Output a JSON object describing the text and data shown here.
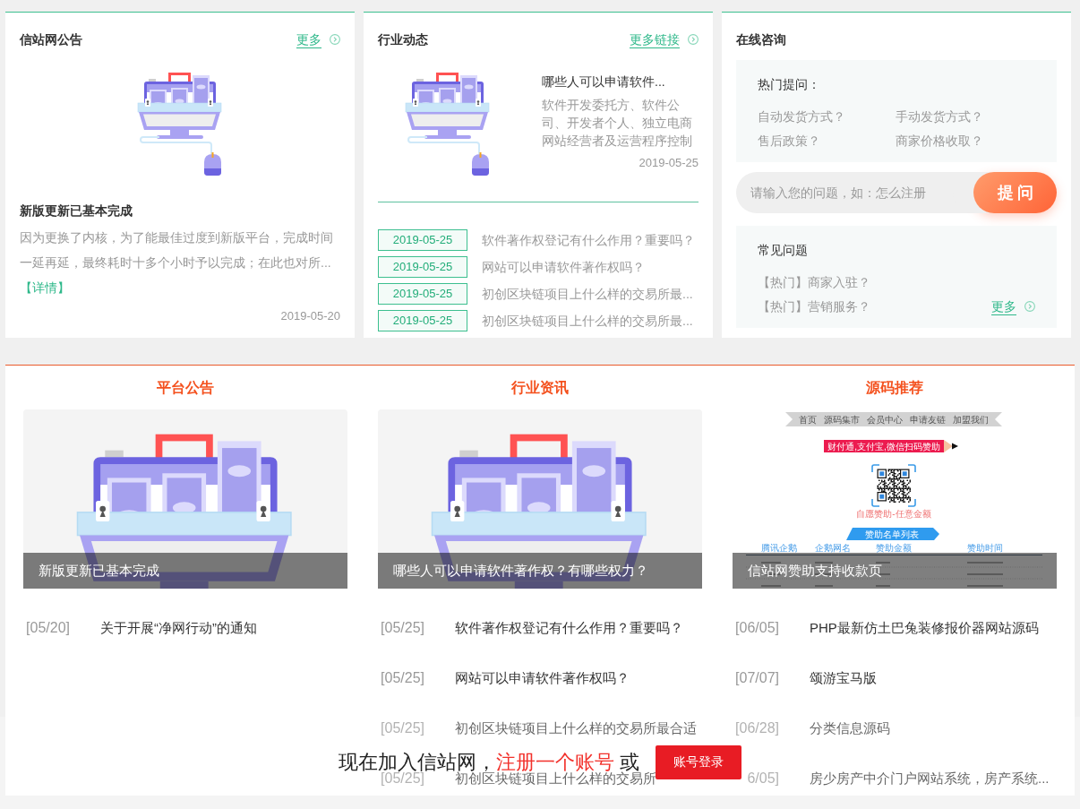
{
  "notice_card": {
    "title": "信站网公告",
    "more_link": "更多",
    "headline": "新版更新已基本完成",
    "summary": "因为更换了内核，为了能最佳过度到新版平台，完成时间一延再延，最终耗时十多个小时予以完成；在此也对所...",
    "detail_link": "【详情】",
    "date": "2019-05-20"
  },
  "industry_card": {
    "title": "行业动态",
    "more_link": "更多链接",
    "featured": {
      "title": "哪些人可以申请软件...",
      "summary": "软件开发委托方、软件公司、开发者个人、独立电商网站经营者及运营程序控制",
      "date": "2019-05-25"
    },
    "items": [
      {
        "date": "2019-05-25",
        "title": "软件著作权登记有什么作用？重要吗？"
      },
      {
        "date": "2019-05-25",
        "title": "网站可以申请软件著作权吗？"
      },
      {
        "date": "2019-05-25",
        "title": "初创区块链项目上什么样的交易所最..."
      },
      {
        "date": "2019-05-25",
        "title": "初创区块链项目上什么样的交易所最..."
      }
    ]
  },
  "consult_card": {
    "title": "在线咨询",
    "hot_questions": {
      "heading": "热门提问：",
      "items": [
        "自动发货方式？",
        "手动发货方式？",
        "售后政策？",
        "商家价格收取？"
      ]
    },
    "ask": {
      "placeholder": "请输入您的问题，如：怎么注册",
      "button": "提问"
    },
    "faq": {
      "heading": "常见问题",
      "items": [
        "【热门】商家入驻？",
        "【热门】营销服务？"
      ],
      "more_link": "更多"
    }
  },
  "columns": [
    {
      "title": "平台公告",
      "feature": {
        "kind": "illustration",
        "caption": "新版更新已基本完成"
      },
      "items": [
        {
          "date": "[05/20]",
          "title": "关于开展“净网行动”的通知"
        }
      ]
    },
    {
      "title": "行业资讯",
      "feature": {
        "kind": "illustration",
        "caption": "哪些人可以申请软件著作权？有哪些权力？"
      },
      "items": [
        {
          "date": "[05/25]",
          "title": "软件著作权登记有什么作用？重要吗？"
        },
        {
          "date": "[05/25]",
          "title": "网站可以申请软件著作权吗？"
        },
        {
          "date": "[05/25]",
          "title": "初创区块链项目上什么样的交易所最合适"
        },
        {
          "date": "[05/25]",
          "title": "初创区块链项目上什么样的交易所"
        }
      ]
    },
    {
      "title": "源码推荐",
      "feature": {
        "kind": "page_thumbnail",
        "caption": "信站网赞助支持收款页",
        "nav": [
          "首页",
          "源码集市",
          "会员中心",
          "申请友链",
          "加盟我们"
        ],
        "banner": "财付通,支付宝,微信扫码赞助",
        "note": "自愿赞助-任意金额",
        "ribbon": "赞助名单列表",
        "columns": [
          "腾讯企鹅",
          "企鹅网名",
          "赞助金额",
          "赞助时间"
        ]
      },
      "items": [
        {
          "date": "[06/05]",
          "title": "PHP最新仿土巴兔装修报价器网站源码"
        },
        {
          "date": "[07/07]",
          "title": "颂游宝马版"
        },
        {
          "date": "[06/28]",
          "title": "分类信息源码"
        },
        {
          "date": "6/05]",
          "title": "房少房产中介门户网站系统，房产系统..."
        }
      ]
    }
  ],
  "join_bar": {
    "prompt": "现在加入信站网，",
    "register_link": "注册一个账号",
    "prompt_end": "或",
    "login_button": "账号登录"
  }
}
